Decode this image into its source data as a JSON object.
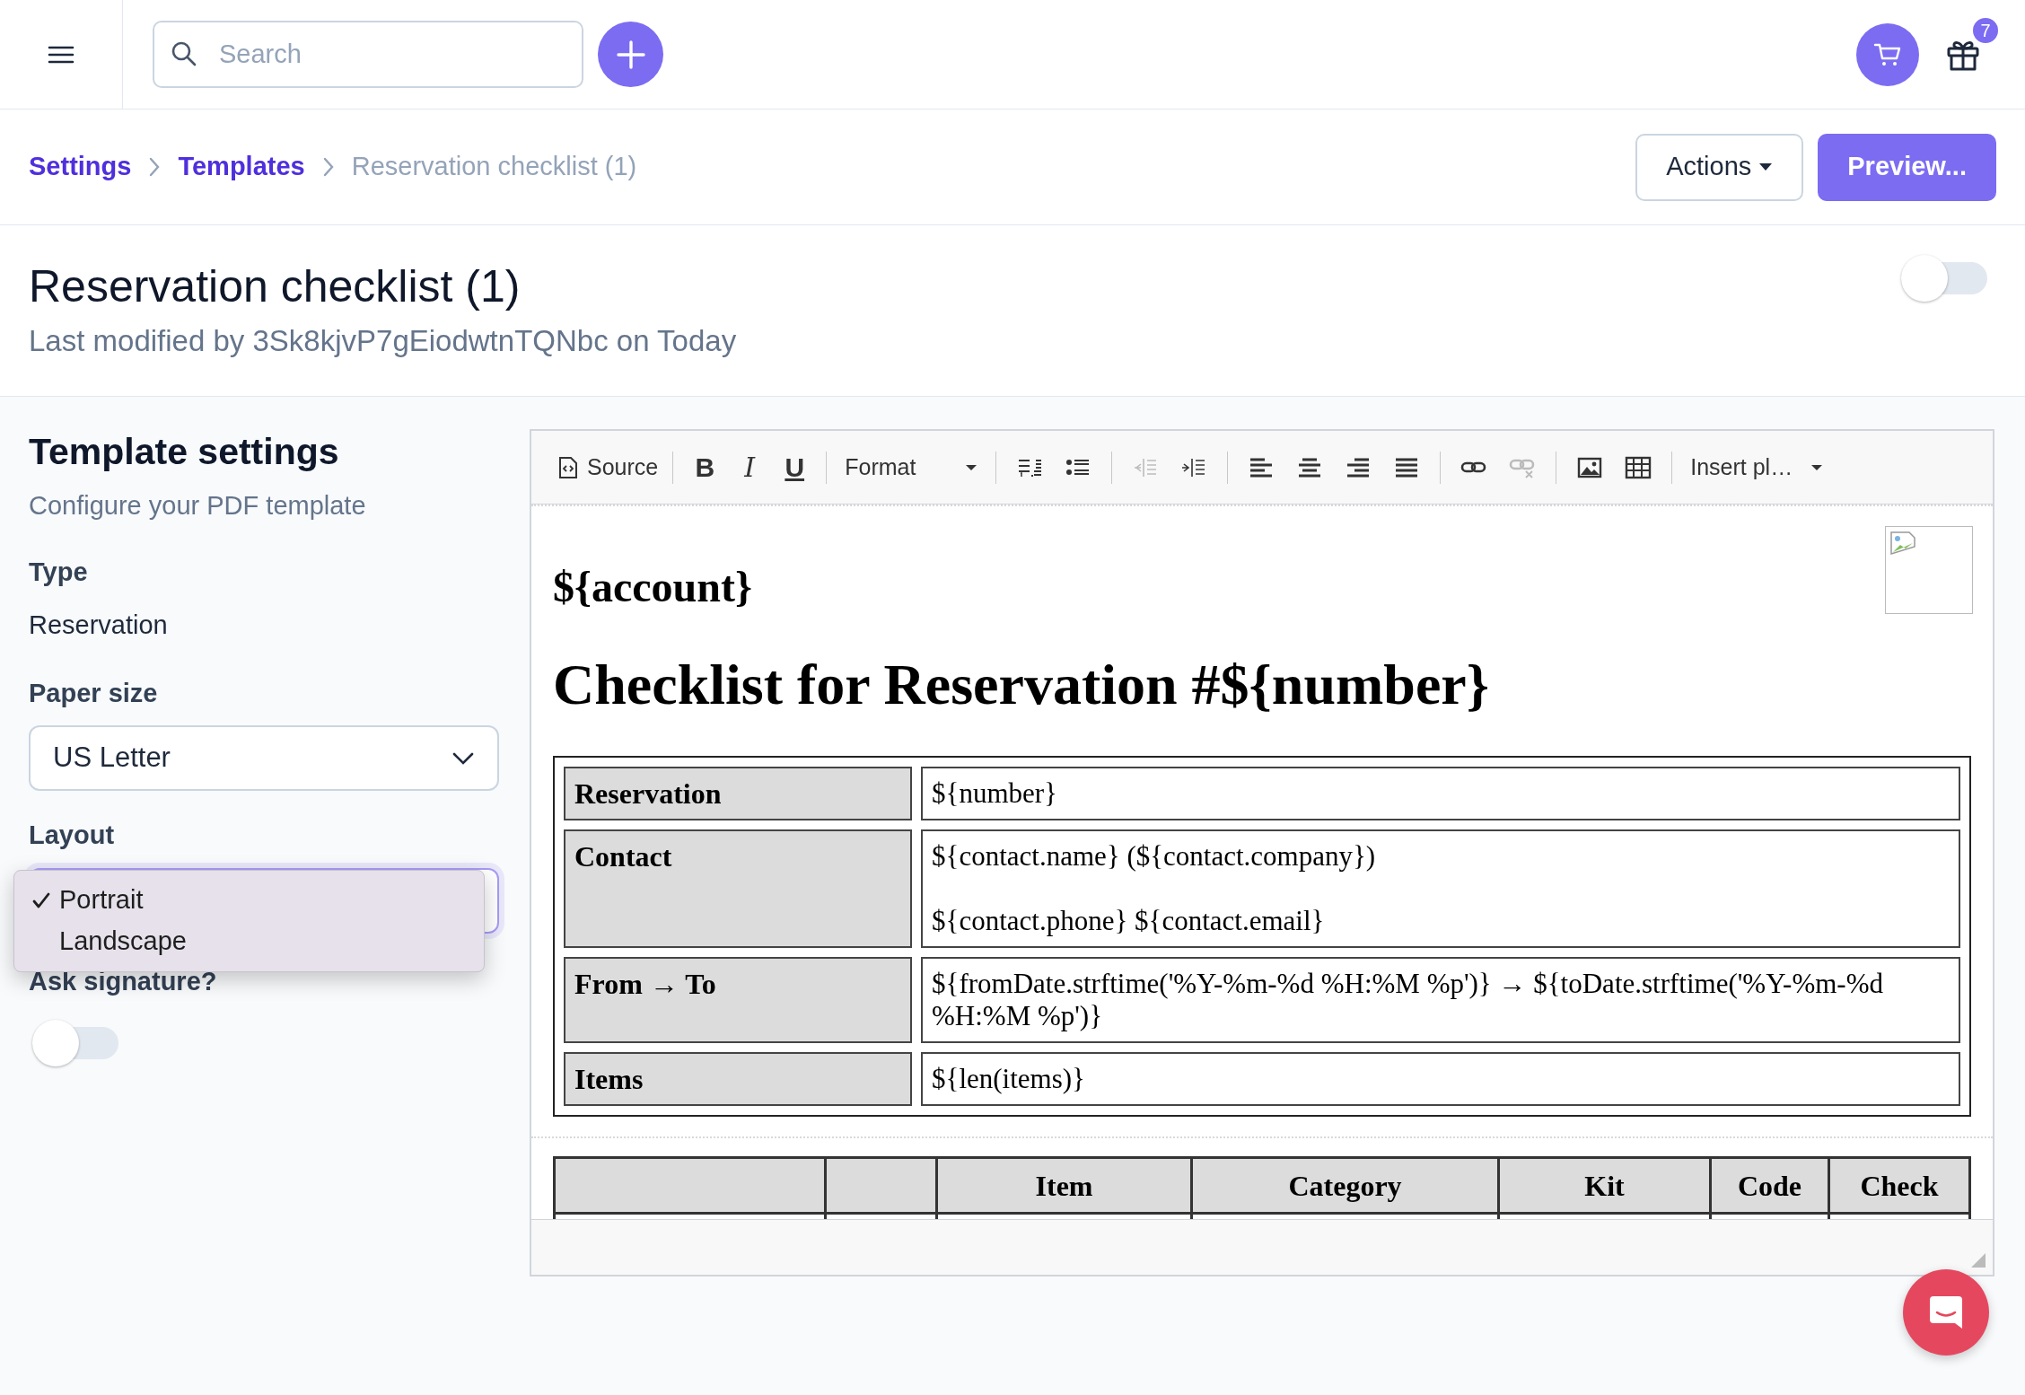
{
  "topbar": {
    "search": {
      "placeholder": "Search"
    },
    "gift_badge": "7"
  },
  "breadcrumb": {
    "items": [
      {
        "label": "Settings",
        "current": false
      },
      {
        "label": "Templates",
        "current": false
      },
      {
        "label": "Reservation checklist (1)",
        "current": true
      }
    ],
    "actions": "Actions",
    "preview": "Preview..."
  },
  "header": {
    "title": "Reservation checklist (1)",
    "subtitle": "Last modified by 3Sk8kjvP7gEiodwtnTQNbc on Today",
    "toggle": {
      "on": false
    }
  },
  "settings": {
    "title": "Template settings",
    "description": "Configure your PDF template",
    "type": {
      "label": "Type",
      "value": "Reservation"
    },
    "paper_size": {
      "label": "Paper size",
      "value": "US Letter"
    },
    "layout": {
      "label": "Layout",
      "options": [
        {
          "label": "Portrait",
          "selected": true
        },
        {
          "label": "Landscape",
          "selected": false
        }
      ]
    },
    "ask_signature": {
      "label": "Ask signature?",
      "on": false
    }
  },
  "editor": {
    "toolbar": [
      [
        {
          "kind": "labeled",
          "label": "Source",
          "disabled": false
        }
      ],
      [
        {
          "kind": "glyph",
          "label": "B",
          "disabled": false
        },
        {
          "kind": "glyph",
          "label": "I",
          "disabled": false
        },
        {
          "kind": "glyph",
          "label": "U",
          "disabled": false
        }
      ],
      [
        {
          "kind": "dropdown",
          "label": "Format",
          "disabled": false
        }
      ],
      [
        {
          "kind": "icon",
          "disabled": false
        },
        {
          "kind": "icon",
          "disabled": false
        }
      ],
      [
        {
          "kind": "icon",
          "disabled": true
        },
        {
          "kind": "icon",
          "disabled": false
        }
      ],
      [
        {
          "kind": "icon",
          "disabled": false
        },
        {
          "kind": "icon",
          "disabled": false
        },
        {
          "kind": "icon",
          "disabled": false
        },
        {
          "kind": "icon",
          "disabled": false
        }
      ],
      [
        {
          "kind": "icon",
          "disabled": false
        },
        {
          "kind": "icon",
          "disabled": true
        }
      ],
      [
        {
          "kind": "icon",
          "disabled": false
        },
        {
          "kind": "icon",
          "disabled": false
        }
      ],
      [
        {
          "kind": "dropdown",
          "label": "Insert pl…",
          "disabled": false
        }
      ]
    ],
    "document": {
      "account": "${account}",
      "heading": "Checklist for Reservation #${number}",
      "info_rows": [
        {
          "label": "Reservation",
          "lines": [
            "${number}"
          ]
        },
        {
          "label": "Contact",
          "lines": [
            "${contact.name} (${contact.company})",
            "${contact.phone} ${contact.email}"
          ]
        },
        {
          "label": "From → To",
          "lines": [
            "${fromDate.strftime('%Y-%m-%d %H:%M %p')} → ${toDate.strftime('%Y-%m-%d %H:%M %p')}"
          ]
        },
        {
          "label": "Items",
          "lines": [
            "${len(items)}"
          ]
        }
      ],
      "item_columns": [
        {},
        {},
        {
          "label": "Item"
        },
        {
          "label": "Category"
        },
        {
          "label": "Kit"
        },
        {
          "label": "Code"
        },
        {
          "label": "Check"
        }
      ]
    }
  }
}
